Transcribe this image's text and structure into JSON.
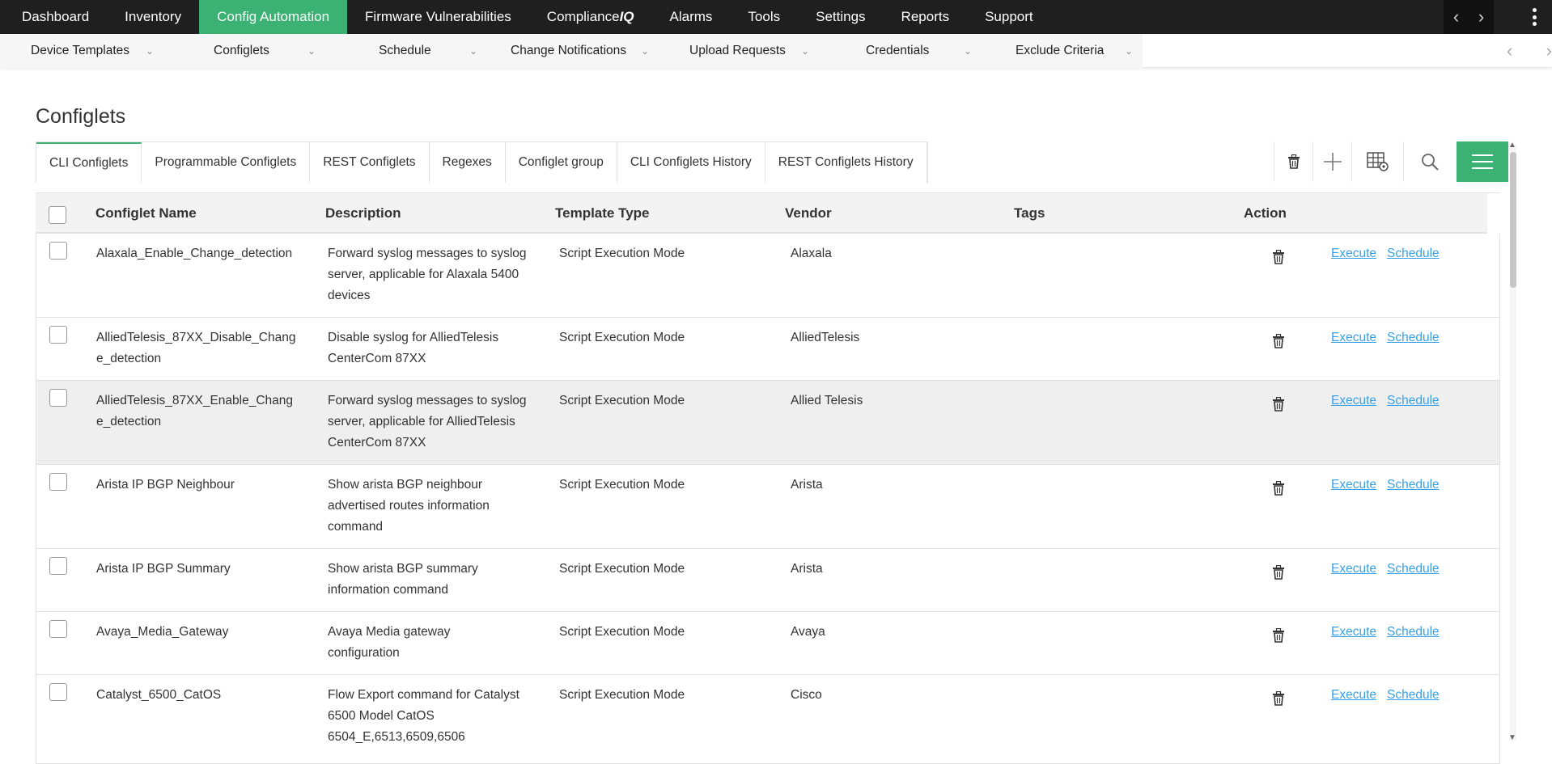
{
  "topnav": {
    "items": [
      {
        "label": "Dashboard",
        "active": false
      },
      {
        "label": "Inventory",
        "active": false
      },
      {
        "label": "Config Automation",
        "active": true
      },
      {
        "label": "Firmware Vulnerabilities",
        "active": false
      },
      {
        "label": "Compliance",
        "suffix": "IQ",
        "active": false
      },
      {
        "label": "Alarms",
        "active": false
      },
      {
        "label": "Tools",
        "active": false
      },
      {
        "label": "Settings",
        "active": false
      },
      {
        "label": "Reports",
        "active": false
      },
      {
        "label": "Support",
        "active": false
      }
    ],
    "prev_icon": "chevron-left-icon",
    "next_icon": "chevron-right-icon",
    "more_icon": "kebab-menu-icon"
  },
  "subnav": {
    "items": [
      {
        "label": "Device Templates"
      },
      {
        "label": "Configlets"
      },
      {
        "label": "Schedule"
      },
      {
        "label": "Change Notifications"
      },
      {
        "label": "Upload Requests"
      },
      {
        "label": "Credentials"
      },
      {
        "label": "Exclude Criteria"
      }
    ]
  },
  "page": {
    "title": "Configlets"
  },
  "tabs": [
    {
      "label": "CLI Configlets",
      "active": true
    },
    {
      "label": "Programmable Configlets",
      "active": false
    },
    {
      "label": "REST Configlets",
      "active": false
    },
    {
      "label": "Regexes",
      "active": false
    },
    {
      "label": "Configlet group",
      "active": false
    },
    {
      "label": "CLI Configlets History",
      "active": false
    },
    {
      "label": "REST Configlets History",
      "active": false
    }
  ],
  "toolbar": {
    "icons": [
      "trash-icon",
      "add-icon",
      "table-settings-icon",
      "search-icon",
      "hamburger-menu-icon"
    ]
  },
  "table": {
    "columns": {
      "name": "Configlet Name",
      "description": "Description",
      "template_type": "Template Type",
      "vendor": "Vendor",
      "tags": "Tags",
      "action": "Action"
    },
    "rows": [
      {
        "name": [
          "Alaxala_Enable_Change_detection"
        ],
        "description": [
          "Forward syslog messages to syslog",
          "server, applicable for Alaxala 5400",
          "devices"
        ],
        "template_type": "Script Execution Mode",
        "vendor": "Alaxala",
        "tags": "",
        "execute": "Execute",
        "schedule": "Schedule"
      },
      {
        "name": [
          "AlliedTelesis_87XX_Disable_Chang",
          "e_detection"
        ],
        "description": [
          "Disable syslog for AlliedTelesis",
          "CenterCom 87XX"
        ],
        "template_type": "Script Execution Mode",
        "vendor": "AlliedTelesis",
        "tags": "",
        "execute": "Execute",
        "schedule": "Schedule"
      },
      {
        "name": [
          "AlliedTelesis_87XX_Enable_Chang",
          "e_detection"
        ],
        "description": [
          "Forward syslog messages to syslog",
          "server, applicable for AlliedTelesis",
          "CenterCom 87XX"
        ],
        "template_type": "Script Execution Mode",
        "vendor": "Allied Telesis",
        "tags": "",
        "execute": "Execute",
        "schedule": "Schedule"
      },
      {
        "name": [
          "Arista IP BGP Neighbour"
        ],
        "description": [
          "Show arista BGP neighbour",
          "advertised routes information",
          "command"
        ],
        "template_type": "Script Execution Mode",
        "vendor": "Arista",
        "tags": "",
        "execute": "Execute",
        "schedule": "Schedule"
      },
      {
        "name": [
          "Arista IP BGP Summary"
        ],
        "description": [
          "Show arista BGP summary",
          "information command"
        ],
        "template_type": "Script Execution Mode",
        "vendor": "Arista",
        "tags": "",
        "execute": "Execute",
        "schedule": "Schedule"
      },
      {
        "name": [
          "Avaya_Media_Gateway"
        ],
        "description": [
          "Avaya Media gateway",
          "configuration"
        ],
        "template_type": "Script Execution Mode",
        "vendor": "Avaya",
        "tags": "",
        "execute": "Execute",
        "schedule": "Schedule"
      },
      {
        "name": [
          "Catalyst_6500_CatOS"
        ],
        "description": [
          "Flow Export command for Catalyst",
          "6500 Model CatOS",
          "6504_E,6513,6509,6506"
        ],
        "template_type": "Script Execution Mode",
        "vendor": "Cisco",
        "tags": "",
        "execute": "Execute",
        "schedule": "Schedule"
      }
    ],
    "highlighted_row": 2
  },
  "colors": {
    "topnav_bg": "#1f1f1f",
    "accent": "#3bb273",
    "link": "#3aa0e6",
    "header_bg": "#f3f3f3",
    "highlight_row": "#efefef"
  }
}
